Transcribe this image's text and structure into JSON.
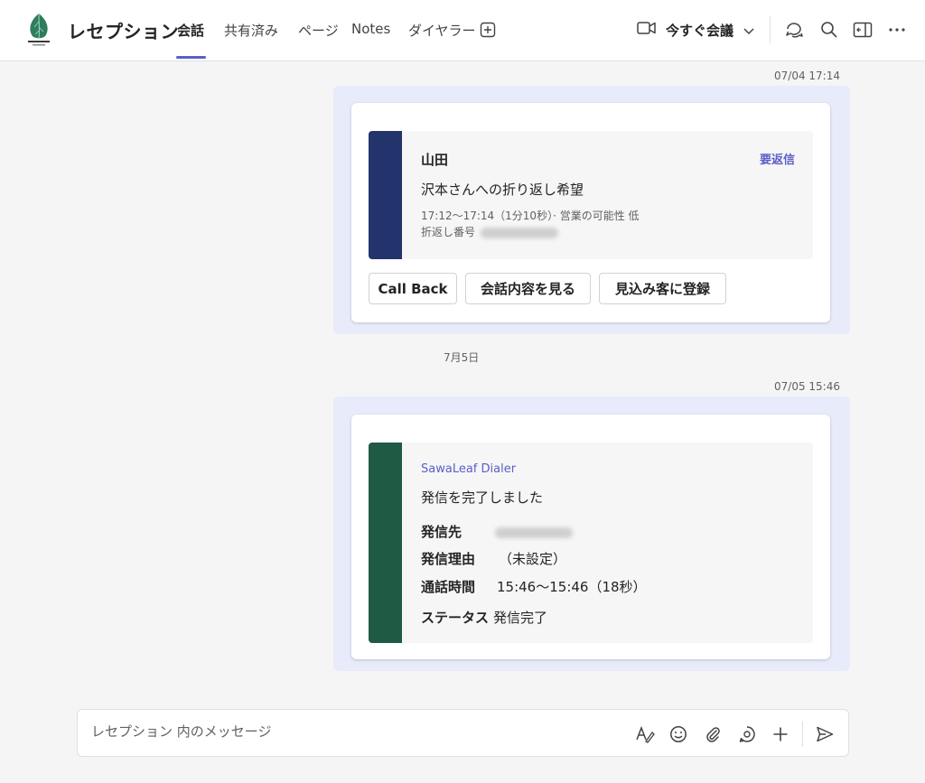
{
  "header": {
    "channel_title": "レセプション",
    "tabs": [
      {
        "label": "会話",
        "active": true
      },
      {
        "label": "共有済み"
      },
      {
        "label": "ページ"
      },
      {
        "label": "Notes"
      },
      {
        "label": "ダイヤラー"
      }
    ],
    "meet_now_label": "今すぐ会議",
    "icons": [
      "add-tab-icon",
      "video-camera-icon",
      "chevron-down-icon",
      "chat-icon",
      "search-icon",
      "panel-icon",
      "more-icon"
    ]
  },
  "messages": [
    {
      "timestamp": "07/04 17:14",
      "card": {
        "caller": "山田",
        "tag": "要返信",
        "message": "沢本さんへの折り返し希望",
        "meta_line1": "17:12～17:14（1分10秒）· 営業の可能性 低",
        "meta_line2_label": "折返し番号",
        "buttons": [
          "Call Back",
          "会話内容を見る",
          "見込み客に登録"
        ],
        "bar_color": "#23336b"
      }
    },
    {
      "date_separator": "7月5日",
      "timestamp": "07/05 15:46",
      "card": {
        "app_name": "SawaLeaf Dialer",
        "status_line": "発信を完了しました",
        "fields": [
          {
            "label": "発信先",
            "value": ""
          },
          {
            "label": "発信理由",
            "value": "（未設定）"
          },
          {
            "label": "通話時間",
            "value": "15:46～15:46（18秒）"
          },
          {
            "label": "ステータス",
            "value": "発信完了"
          }
        ],
        "bar_color": "#1f5a44"
      }
    }
  ],
  "compose": {
    "placeholder": "レセプション 内のメッセージ",
    "icons": [
      "format-icon",
      "emoji-icon",
      "attach-icon",
      "loop-icon",
      "plus-icon",
      "send-icon"
    ]
  },
  "colors": {
    "accent": "#5b5fc7",
    "bubble": "#e8ebfa",
    "background": "#f5f5f5"
  }
}
